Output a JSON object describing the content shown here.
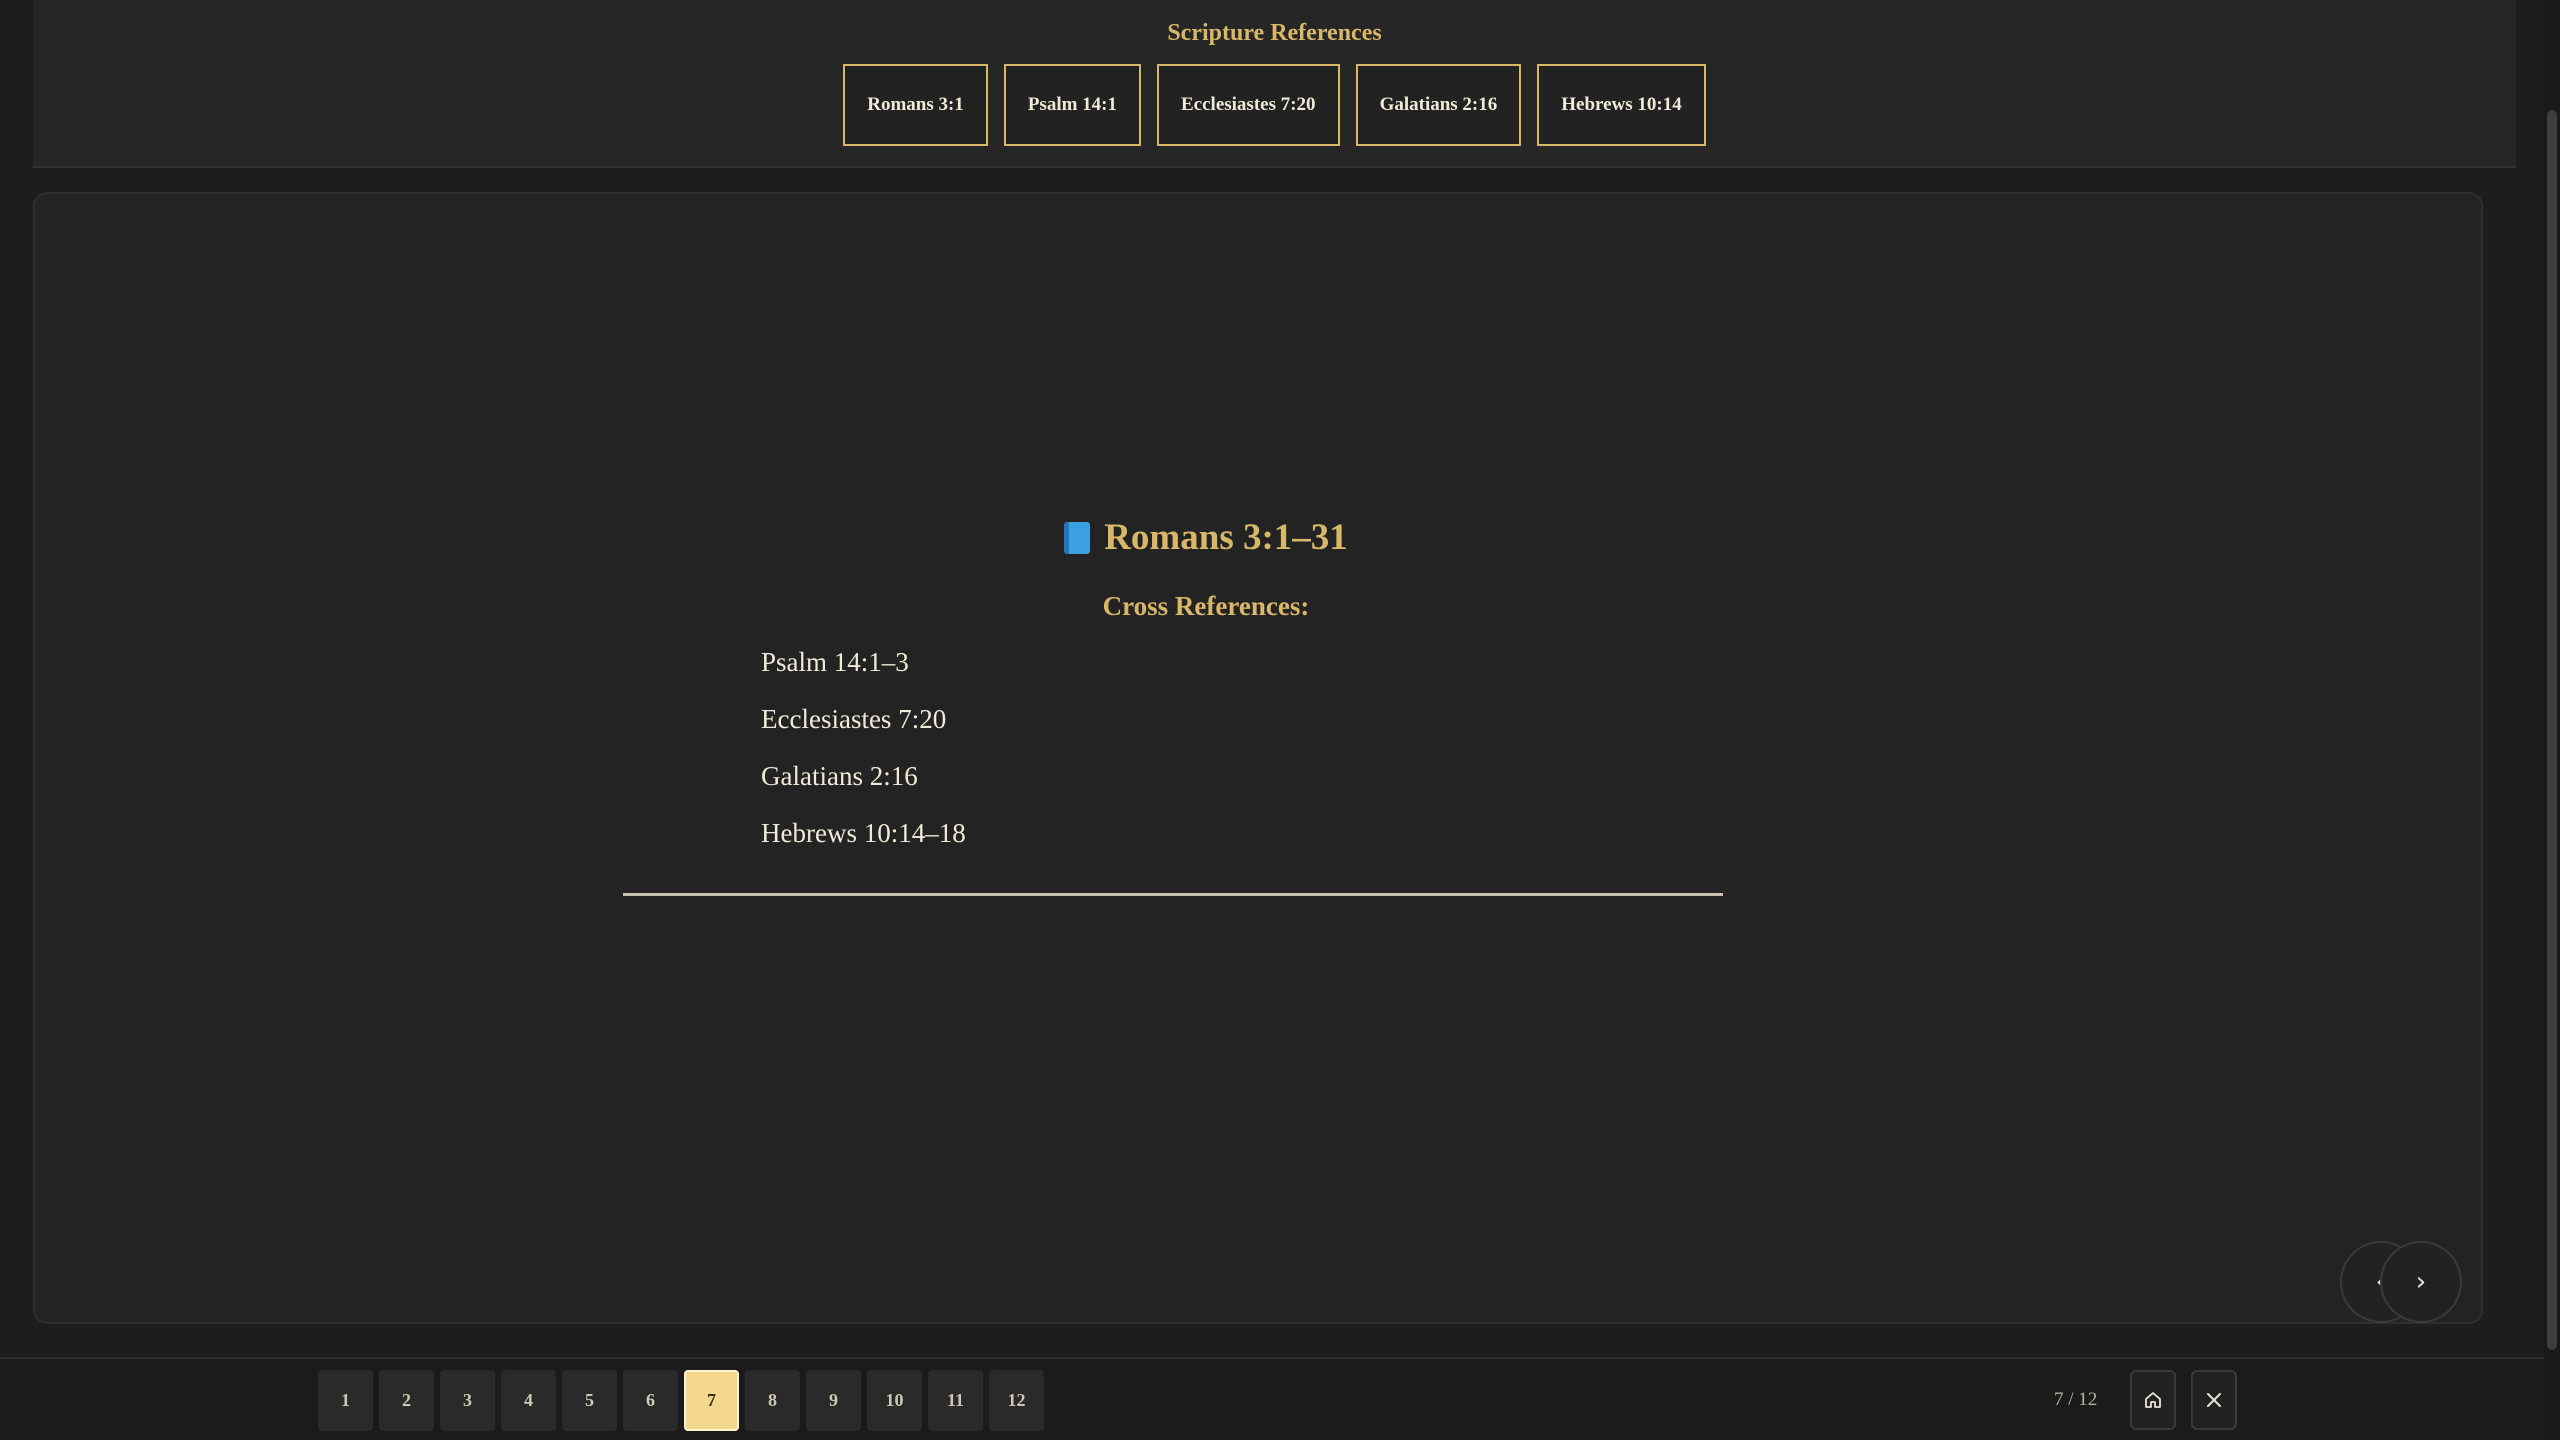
{
  "refs_panel": {
    "title": "Scripture References",
    "buttons": [
      "Romans 3:1",
      "Psalm 14:1",
      "Ecclesiastes 7:20",
      "Galatians 2:16",
      "Hebrews 10:14"
    ]
  },
  "slide": {
    "icon": "book-icon",
    "heading": "Romans 3:1–31",
    "cross_title": "Cross References:",
    "cross_refs": [
      "Psalm 14:1–3",
      "Ecclesiastes 7:20",
      "Galatians 2:16",
      "Hebrews 10:14–18"
    ]
  },
  "nav": {
    "prev_label": "‹",
    "next_label": "›"
  },
  "pager": {
    "pages": [
      "1",
      "2",
      "3",
      "4",
      "5",
      "6",
      "7",
      "8",
      "9",
      "10",
      "11",
      "12"
    ],
    "active": "7",
    "count_text": "7 / 12"
  },
  "colors": {
    "accent": "#d8b868",
    "active_page": "#f2d78c",
    "background": "#1d1d1d"
  }
}
